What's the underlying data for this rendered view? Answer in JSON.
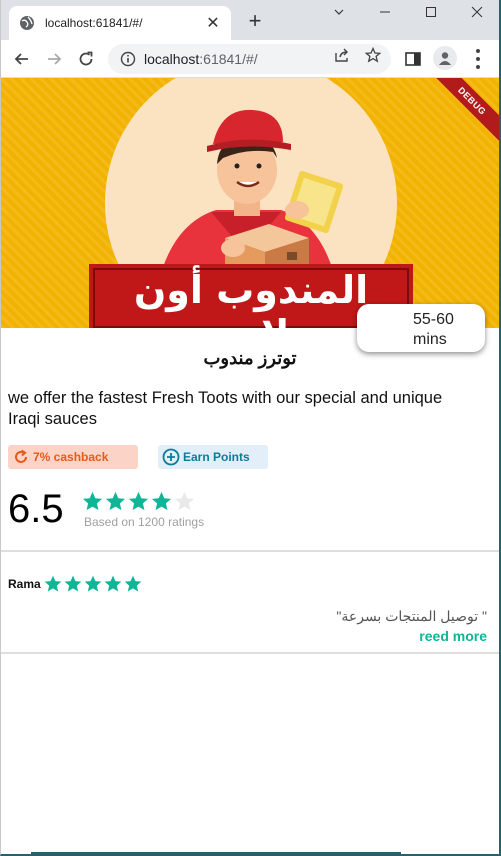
{
  "browser": {
    "tab_title": "localhost:61841/#/",
    "url_host": "localhost",
    "url_path": ":61841/#/"
  },
  "banner": {
    "sign_text": "المندوب أون لاين",
    "debug_label": "DEBUG"
  },
  "delivery_time": {
    "line1": "55-60",
    "line2": "mins"
  },
  "store": {
    "name": "توترز مندوب",
    "description": "we offer the fastest Fresh Toots with our special and unique Iraqi sauces"
  },
  "chips": {
    "cashback": "7% cashback",
    "points": "Earn Points"
  },
  "rating": {
    "value": "6.5",
    "stars": 4,
    "max_stars": 5,
    "count_text": "Based on 1200 ratings"
  },
  "review": {
    "user": "Rama",
    "stars": 5,
    "text": "\" توصيل المنتجات بسرعة\"",
    "read_more": "reed more"
  },
  "colors": {
    "accent_teal": "#10b597",
    "cashback_orange": "#e85a1a",
    "points_blue": "#0c7c99",
    "banner_yellow": "#f2b200",
    "sign_red": "#c01818"
  }
}
